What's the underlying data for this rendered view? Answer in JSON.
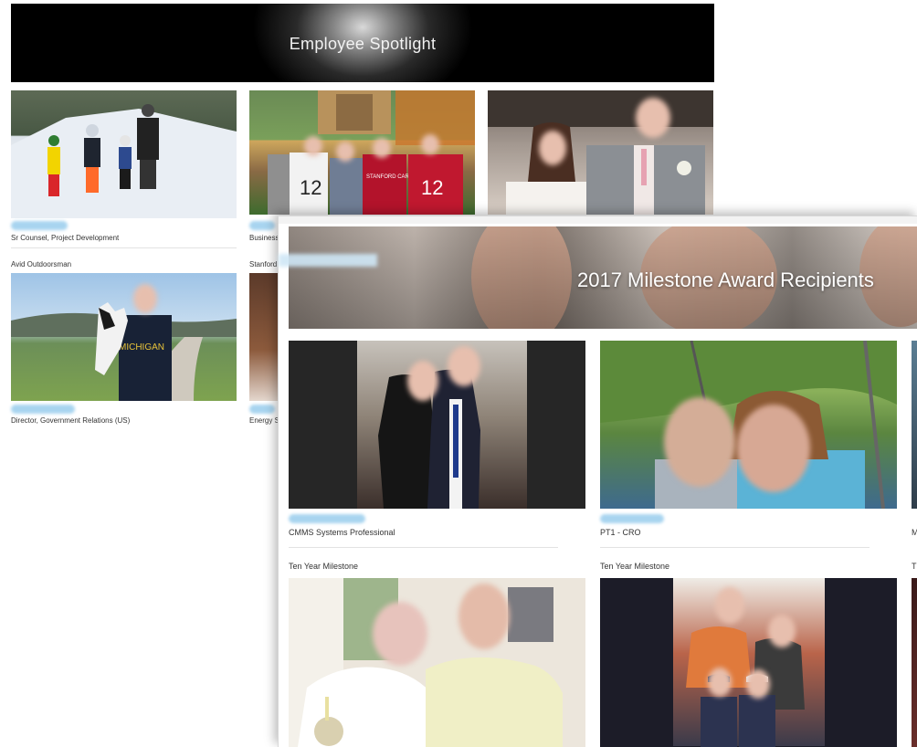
{
  "spotlight": {
    "title": "Employee Spotlight",
    "cards": [
      {
        "role": "Sr Counsel, Project Development"
      },
      {
        "role": "Business"
      },
      {
        "role": ""
      },
      {
        "role": "Director, Government Relations (US)",
        "note": "Avid Outdoorsman"
      },
      {
        "role": "Energy S",
        "note": "Stanford"
      }
    ]
  },
  "milestone": {
    "title": "2017 Milestone Award Recipients",
    "cards": [
      {
        "role": "CMMS Systems Professional",
        "tag": "Ten Year Milestone"
      },
      {
        "role": "PT1 - CRO",
        "tag": "Ten Year Milestone"
      },
      {
        "role": "M",
        "tag": "T"
      }
    ]
  },
  "photo_labels": {
    "jersey1": "12",
    "jersey2": "STANFORD CARDINAL",
    "jersey3": "12",
    "shirt": "MICHIGAN"
  }
}
